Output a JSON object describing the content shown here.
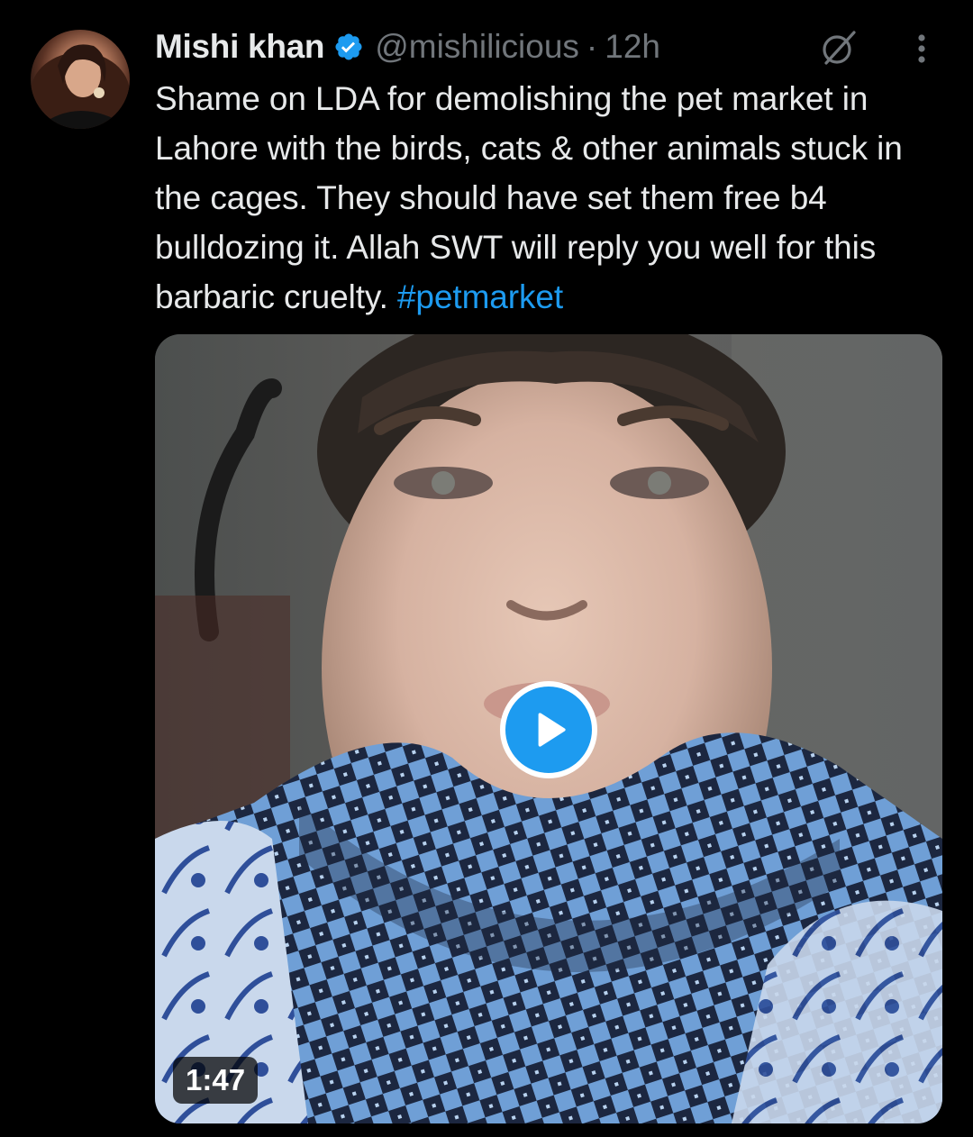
{
  "tweet": {
    "author": {
      "name": "Mishi khan",
      "handle": "@mishilicious",
      "verified": true
    },
    "separator": "·",
    "time": "12h",
    "text": "Shame on LDA for demolishing the pet market in Lahore with the birds, cats & other animals stuck in the cages. They should have set them free b4 bulldozing it. Allah SWT will reply you well for this barbaric cruelty. ",
    "hashtag": "#petmarket",
    "media": {
      "type": "video",
      "duration": "1:47"
    }
  },
  "icons": {
    "verified": "verified-badge-icon",
    "grok": "grok-icon",
    "more": "more-vertical-icon",
    "play": "play-icon"
  },
  "colors": {
    "background": "#000000",
    "text": "#e7e9ea",
    "secondary": "#71767b",
    "accent": "#1d9bf0"
  }
}
